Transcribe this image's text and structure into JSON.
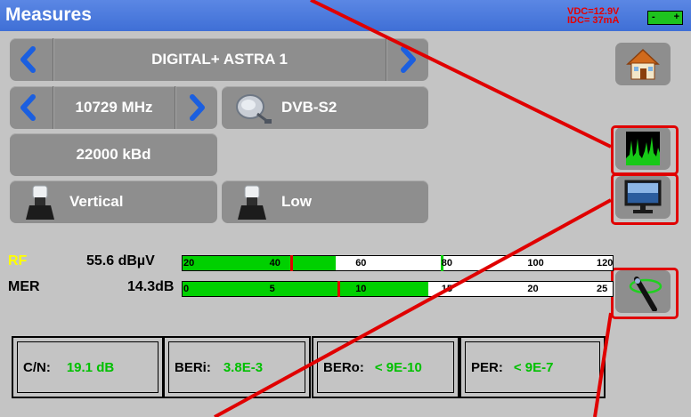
{
  "header": {
    "title": "Measures",
    "vdc": "VDC=12.9V",
    "idc": "IDC= 37mA",
    "battery_minus": "-",
    "battery_plus": "+"
  },
  "satellite": {
    "name": "DIGITAL+ ASTRA 1"
  },
  "frequency": {
    "value": "10729 MHz"
  },
  "standard": {
    "value": "DVB-S2"
  },
  "symbol_rate": {
    "value": "22000 kBd"
  },
  "polarization": {
    "value": "Vertical"
  },
  "band": {
    "value": "Low"
  },
  "icons": {
    "home": "home-icon",
    "spectrum": "spectrum-icon",
    "tv": "tv-monitor-icon",
    "alignment": "antenna-alignment-icon",
    "dish": "satellite-dish-icon",
    "lnb": "lnb-icon",
    "prev": "chevron-left-icon",
    "next": "chevron-right-icon"
  },
  "rf": {
    "label": "RF",
    "value": "55.6 dBµV",
    "ticks": [
      "20",
      "40",
      "60",
      "80",
      "100",
      "120"
    ],
    "range": [
      20,
      120
    ],
    "level": 55.6,
    "red_marker": 45,
    "green_marker": 80
  },
  "mer": {
    "label": "MER",
    "value": "14.3dB",
    "ticks": [
      "0",
      "5",
      "10",
      "15",
      "20",
      "25"
    ],
    "range": [
      0,
      25
    ],
    "level": 14.3,
    "red_marker": 9
  },
  "results": {
    "cn_label": "C/N:",
    "cn_value": "19.1 dB",
    "beri_label": "BERi:",
    "beri_value": "3.8E-3",
    "bero_label": "BERo:",
    "bero_value": "< 9E-10",
    "per_label": "PER:",
    "per_value": "< 9E-7"
  },
  "colors": {
    "title_bar": "#4a7ae0",
    "button": "#8e8e8e",
    "meter_fill": "#00d000",
    "highlight": "#e00000",
    "rf_label": "#ffff00",
    "result_value": "#00c000"
  }
}
